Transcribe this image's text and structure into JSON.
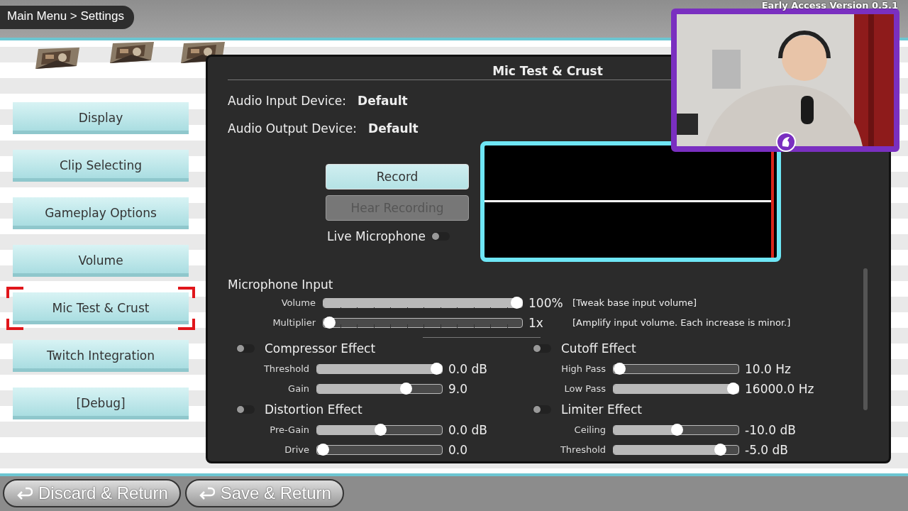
{
  "breadcrumb": "Main Menu > Settings",
  "version": "Early Access Version 0.5.1",
  "menu": [
    {
      "label": "Display",
      "selected": false
    },
    {
      "label": "Clip Selecting",
      "selected": false
    },
    {
      "label": "Gameplay Options",
      "selected": false
    },
    {
      "label": "Volume",
      "selected": false
    },
    {
      "label": "Mic Test & Crust",
      "selected": true
    },
    {
      "label": "Twitch Integration",
      "selected": false
    },
    {
      "label": "[Debug]",
      "selected": false
    }
  ],
  "panel": {
    "title": "Mic Test & Crust",
    "devices": [
      {
        "label": "Audio Input Device:",
        "value": "Default"
      },
      {
        "label": "Audio Output Device:",
        "value": "Default"
      }
    ],
    "buttons": [
      {
        "label": "Record",
        "disabled": false
      },
      {
        "label": "Hear Recording",
        "disabled": true
      }
    ],
    "live_microphone": {
      "label": "Live Microphone",
      "on": false
    },
    "microphone_input": {
      "heading": "Microphone Input",
      "sliders": [
        {
          "label": "Volume",
          "level": 1,
          "reading": "100%",
          "note": "[Tweak base input volume]"
        },
        {
          "label": "Multiplier",
          "level": 0,
          "reading": "1x",
          "note": "[Amplify input volume. Each increase is minor.]"
        }
      ]
    },
    "effects": [
      {
        "title": "Compressor Effect",
        "on": false,
        "sliders": [
          {
            "label": "Threshold",
            "level": 0.96,
            "reading": "0.0 dB"
          },
          {
            "label": "Gain",
            "level": 0.7,
            "reading": "9.0"
          }
        ]
      },
      {
        "title": "Cutoff Effect",
        "on": false,
        "sliders": [
          {
            "label": "High Pass",
            "level": 0,
            "reading": "10.0 Hz"
          },
          {
            "label": "Low Pass",
            "level": 1,
            "reading": "16000.0 Hz"
          }
        ]
      },
      {
        "title": "Distortion Effect",
        "on": false,
        "sliders": [
          {
            "label": "Pre-Gain",
            "level": 0.5,
            "reading": "0.0 dB"
          },
          {
            "label": "Drive",
            "level": 0,
            "reading": "0.0"
          }
        ]
      },
      {
        "title": "Limiter Effect",
        "on": false,
        "sliders": [
          {
            "label": "Ceiling",
            "level": 0.5,
            "reading": "-10.0 dB"
          },
          {
            "label": "Threshold",
            "level": 0.84,
            "reading": "-5.0 dB"
          }
        ]
      }
    ]
  },
  "footer_buttons": [
    {
      "label": "Discard & Return"
    },
    {
      "label": "Save & Return"
    }
  ]
}
